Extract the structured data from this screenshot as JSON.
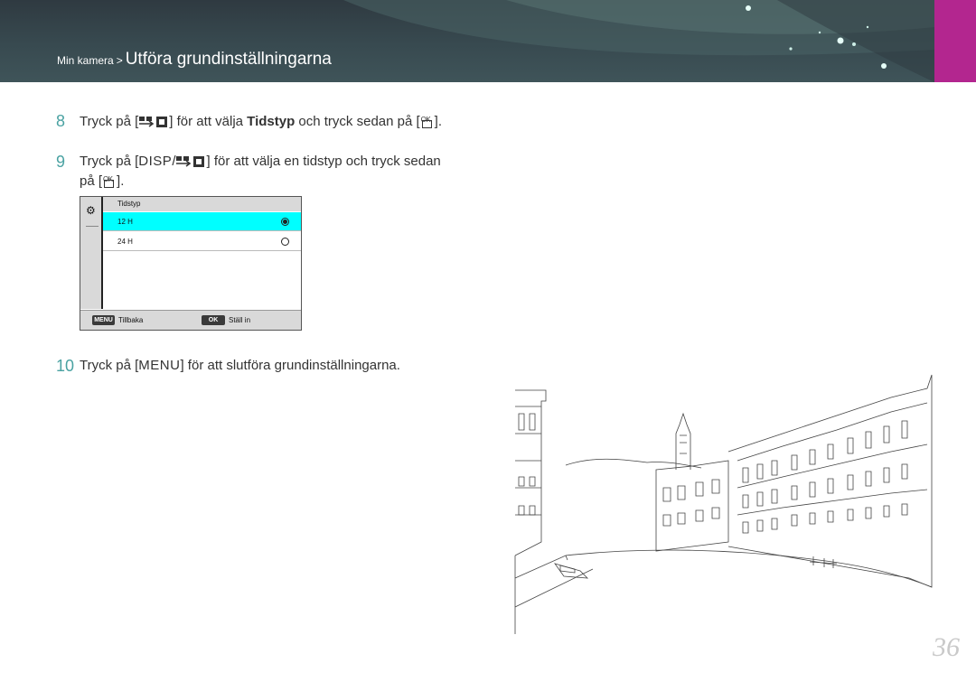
{
  "header": {
    "section": "Min kamera",
    "separator": ">",
    "title": "Utföra grundinställningarna",
    "accent_color": "#b3268f",
    "bg_color": "#3a4a50"
  },
  "steps": [
    {
      "number": "8",
      "pre": "Tryck på [",
      "mid": "] för att välja ",
      "bold": "Tidstyp",
      "post": " och tryck sedan på [",
      "end": "]."
    },
    {
      "number": "9",
      "pre": "Tryck på [",
      "disp": "DISP",
      "slash": "/",
      "mid": "] för att välja en tidstyp och tryck sedan",
      "line2_pre": "på [",
      "line2_end": "]."
    },
    {
      "number": "10",
      "pre": "Tryck på [",
      "menu": "MENU",
      "post": "] för att slutföra grundinställningarna."
    }
  ],
  "ok_key": "OK",
  "screen": {
    "title": "Tidstyp",
    "options": [
      {
        "label": "12 H",
        "selected": true
      },
      {
        "label": "24 H",
        "selected": false
      }
    ],
    "menu_key": "MENU",
    "back_label": "Tillbaka",
    "ok_key": "OK",
    "set_label": "Ställ in",
    "highlight_color": "#00ffff"
  },
  "page_number": "36",
  "icons": [
    "gear-icon",
    "nav-arrows-icon",
    "ok-button-icon",
    "radio-selected-icon",
    "radio-empty-icon"
  ]
}
